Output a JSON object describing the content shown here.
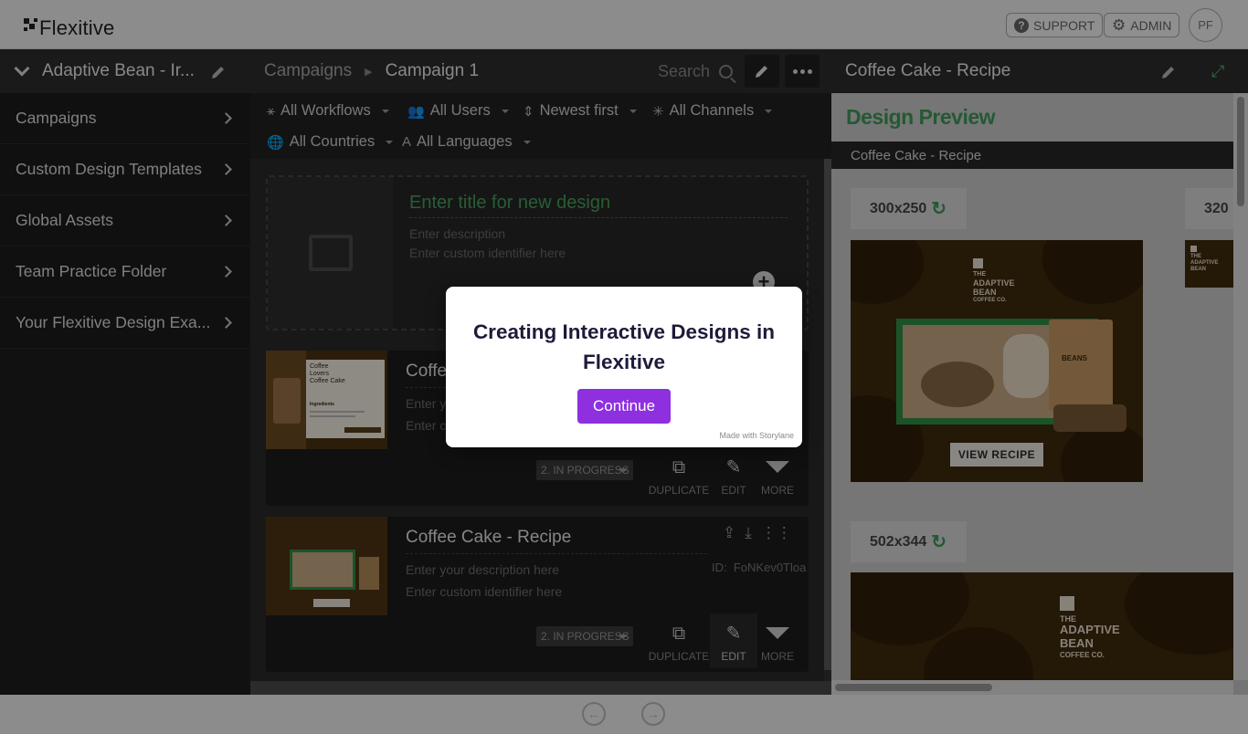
{
  "app": {
    "brand": "Flexitive",
    "support_label": "SUPPORT",
    "admin_label": "ADMIN",
    "avatar_initials": "PF"
  },
  "sidebar": {
    "header": "Adaptive Bean - Ir...",
    "items": [
      {
        "label": "Campaigns"
      },
      {
        "label": "Custom Design Templates"
      },
      {
        "label": "Global Assets"
      },
      {
        "label": "Team Practice Folder"
      },
      {
        "label": "Your Flexitive Design Exa..."
      }
    ]
  },
  "middle": {
    "breadcrumb_root": "Campaigns",
    "breadcrumb_current": "Campaign 1",
    "search_placeholder": "Search",
    "filters": {
      "workflows": "All Workflows",
      "users": "All Users",
      "sort": "Newest first",
      "channels": "All Channels",
      "countries": "All Countries",
      "languages": "All Languages"
    },
    "new_design": {
      "title_placeholder": "Enter title for new design",
      "description_placeholder": "Enter description",
      "identifier_placeholder": "Enter custom identifier here"
    },
    "designs": [
      {
        "title": "Coffee Lovers Coffee Cake",
        "title_visible": "Coffee",
        "description_placeholder": "Enter your description here",
        "identifier_placeholder": "Enter custom identifier here",
        "status": "2. IN PROGRESS",
        "actions": {
          "duplicate": "DUPLICATE",
          "edit": "EDIT",
          "more": "MORE"
        },
        "thumb_heading": "Coffee Lovers Coffee Cake",
        "thumb_sub": "Ingredients"
      },
      {
        "title": "Coffee Cake - Recipe",
        "description_placeholder": "Enter your description here",
        "identifier_placeholder": "Enter custom identifier here",
        "id_label": "ID:",
        "id_value": "FoNKev0Tloa",
        "status": "2. IN PROGRESS",
        "actions": {
          "duplicate": "DUPLICATE",
          "edit": "EDIT",
          "more": "MORE"
        }
      }
    ]
  },
  "right": {
    "header": "Coffee Cake - Recipe",
    "preview_title": "Design Preview",
    "preview_bar": "Coffee Cake - Recipe",
    "sizes": [
      {
        "label": "300x250"
      },
      {
        "label": "320"
      },
      {
        "label": "502x344"
      }
    ],
    "ad": {
      "brand_line1": "THE",
      "brand_line2": "ADAPTIVE",
      "brand_line3": "BEAN",
      "brand_line4": "COFFEE CO.",
      "cta": "VIEW RECIPE",
      "bag_label": "BEANS"
    }
  },
  "modal": {
    "title": "Creating Interactive Designs in Flexitive",
    "button": "Continue",
    "credit": "Made with Storylane"
  },
  "colors": {
    "accent_green": "#3f9a58",
    "modal_button": "#8e2fe0",
    "sidebar_bg": "#1e1e1e"
  }
}
